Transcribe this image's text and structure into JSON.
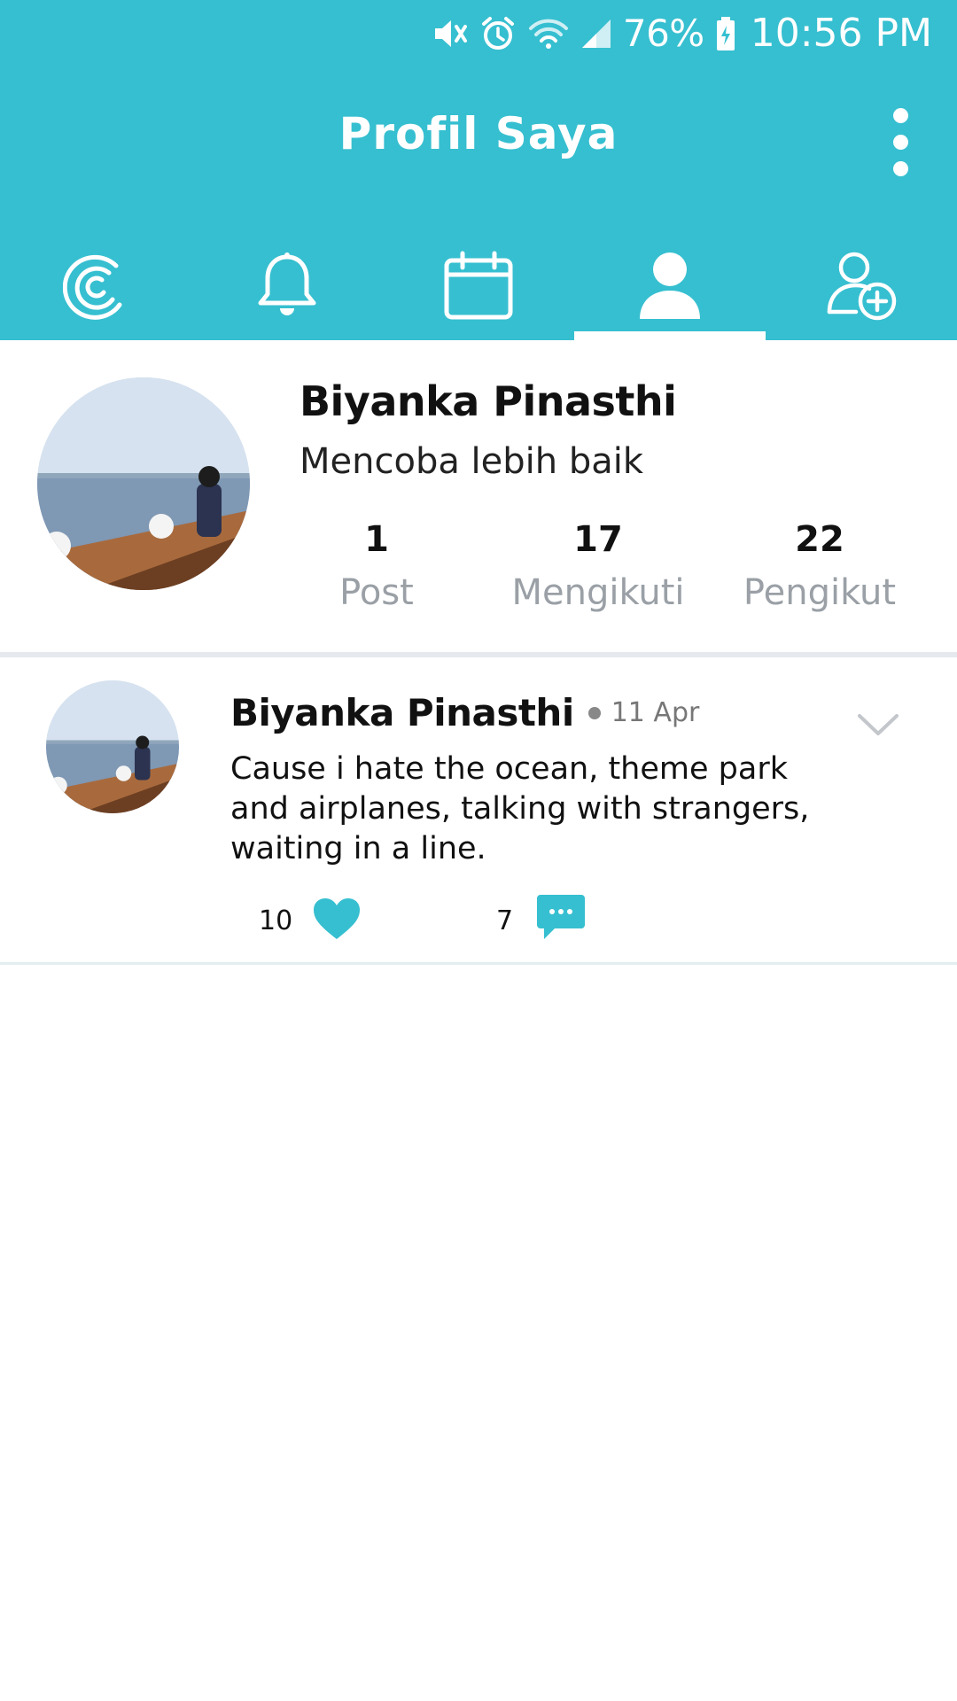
{
  "colors": {
    "accent": "#36BFD0",
    "muted_text": "#9aa0a6",
    "divider": "#e6e9ee"
  },
  "status_bar": {
    "icons": [
      "mute-icon",
      "alarm-icon",
      "wifi-icon",
      "signal-icon",
      "battery-charging-icon"
    ],
    "battery": "76%",
    "time": "10:56 PM"
  },
  "header": {
    "title": "Profil Saya",
    "more_icon": "more-vert-icon"
  },
  "tabs": [
    {
      "icon": "home-logo-icon",
      "selected": false
    },
    {
      "icon": "bell-icon",
      "selected": false
    },
    {
      "icon": "calendar-icon",
      "selected": false
    },
    {
      "icon": "profile-icon",
      "selected": true
    },
    {
      "icon": "add-friend-icon",
      "selected": false
    }
  ],
  "profile": {
    "name": "Biyanka Pinasthi",
    "bio": "Mencoba lebih baik",
    "stats": [
      {
        "value": "1",
        "label": "Post"
      },
      {
        "value": "17",
        "label": "Mengikuti"
      },
      {
        "value": "22",
        "label": "Pengikut"
      }
    ]
  },
  "posts": [
    {
      "author": "Biyanka Pinasthi",
      "date": "11 Apr",
      "text": "Cause i hate the ocean, theme park and airplanes, talking with strangers, waiting in a line.",
      "likes": "10",
      "comments": "7"
    }
  ]
}
